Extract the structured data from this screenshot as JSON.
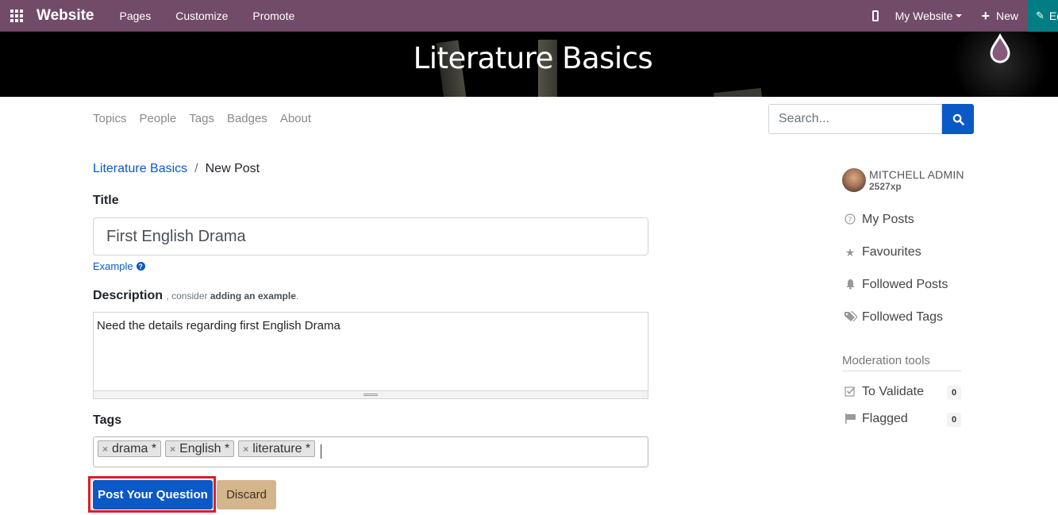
{
  "topbar": {
    "brand": "Website",
    "menus": [
      "Pages",
      "Customize",
      "Promote"
    ],
    "website_selector": "My Website",
    "new_label": "New",
    "edit_label": "Edit",
    "bg_color": "#714b67",
    "edit_color": "#017e84"
  },
  "hero": {
    "title": "Literature Basics"
  },
  "forum_nav": {
    "items": [
      "Topics",
      "People",
      "Tags",
      "Badges",
      "About"
    ]
  },
  "search": {
    "placeholder": "Search..."
  },
  "breadcrumb": {
    "parent": "Literature Basics",
    "separator": "/",
    "current": "New Post"
  },
  "form": {
    "title_label": "Title",
    "title_value": "First English Drama",
    "example_link": "Example",
    "description_label": "Description",
    "description_hint_prefix": ", consider",
    "description_hint_bold": "adding an example",
    "description_hint_suffix": ".",
    "description_value": "Need the details regarding first English Drama",
    "tags_label": "Tags",
    "tags": [
      "drama *",
      "English *",
      "literature *"
    ],
    "tag_remove": "×",
    "post_button": "Post Your Question",
    "discard_button": "Discard"
  },
  "sidebar": {
    "user_name": "MITCHELL ADMIN",
    "user_xp": "2527xp",
    "items": [
      {
        "label": "My Posts",
        "icon": "question-circle-icon"
      },
      {
        "label": "Favourites",
        "icon": "star-icon"
      },
      {
        "label": "Followed Posts",
        "icon": "bell-icon"
      },
      {
        "label": "Followed Tags",
        "icon": "tags-icon"
      }
    ],
    "moderation_title": "Moderation tools",
    "moderation": [
      {
        "label": "To Validate",
        "count": "0",
        "icon": "check-square-icon"
      },
      {
        "label": "Flagged",
        "count": "0",
        "icon": "flag-icon"
      }
    ]
  }
}
